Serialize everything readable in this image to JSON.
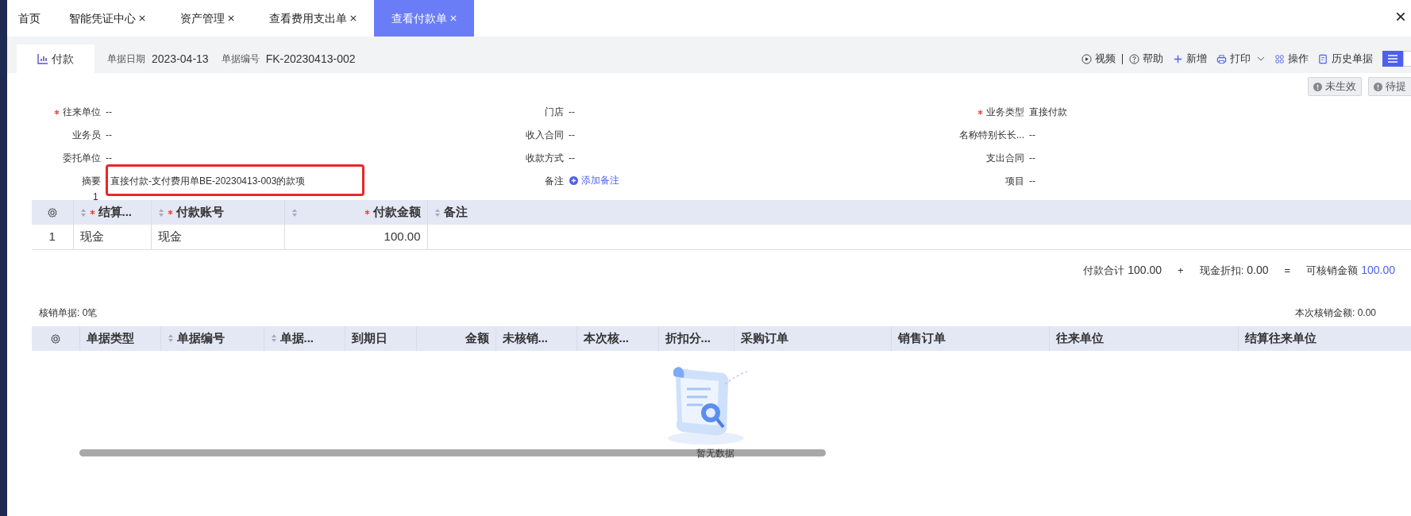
{
  "tabs": [
    {
      "label": "首页",
      "closable": false,
      "selected": false
    },
    {
      "label": "智能凭证中心",
      "closable": true,
      "selected": false
    },
    {
      "label": "资产管理",
      "closable": true,
      "selected": false
    },
    {
      "label": "查看费用支出单",
      "closable": true,
      "selected": false
    },
    {
      "label": "查看付款单",
      "closable": true,
      "selected": true
    }
  ],
  "doc_tab": "付款",
  "doc_meta": [
    {
      "label": "单据日期",
      "value": "2023-04-13"
    },
    {
      "label": "单据编号",
      "value": "FK-20230413-002"
    }
  ],
  "toolbar": [
    "视频",
    "帮助",
    "新增",
    "打印",
    "操作",
    "历史单据"
  ],
  "status_buttons": [
    "未生效",
    "待提"
  ],
  "form_rows": [
    [
      {
        "label": "往来单位",
        "value": "--",
        "required": true,
        "kind": "text"
      },
      {
        "label": "门店",
        "value": "--",
        "required": false,
        "kind": "text"
      },
      {
        "label": "业务类型",
        "value": "直接付款",
        "required": true,
        "kind": "text"
      }
    ],
    [
      {
        "label": "业务员",
        "value": "--",
        "required": false,
        "kind": "text"
      },
      {
        "label": "收入合同",
        "value": "--",
        "required": false,
        "kind": "text"
      },
      {
        "label": "名称特别长长...",
        "value": "--",
        "required": false,
        "kind": "text"
      }
    ],
    [
      {
        "label": "委托单位",
        "value": "--",
        "required": false,
        "kind": "text"
      },
      {
        "label": "收款方式",
        "value": "--",
        "required": false,
        "kind": "text"
      },
      {
        "label": "支出合同",
        "value": "--",
        "required": false,
        "kind": "text"
      }
    ],
    [
      {
        "label": "摘要",
        "value": "直接付款-支付费用单BE-20230413-003的款项",
        "required": false,
        "kind": "highlighted",
        "counter": "1"
      },
      {
        "label": "备注",
        "value": "添加备注",
        "required": false,
        "kind": "link"
      },
      {
        "label": "项目",
        "value": "--",
        "required": false,
        "kind": "text"
      }
    ]
  ],
  "payment_table": {
    "columns": [
      {
        "kind": "settings"
      },
      {
        "label": "结算...",
        "required": true,
        "sortable": true
      },
      {
        "label": "付款账号",
        "required": true,
        "sortable": true
      },
      {
        "label": "付款金额",
        "required": true,
        "sortable": true
      },
      {
        "label": "备注",
        "required": false,
        "sortable": true
      }
    ],
    "rows": [
      [
        "1",
        "现金",
        "现金",
        "100.00"
      ]
    ]
  },
  "totals": [
    {
      "label": "付款合计",
      "value": "100.00",
      "accent": false
    },
    {
      "label": "现金折扣:",
      "value": "0.00",
      "accent": false
    },
    {
      "label": "可核销金额",
      "value": "100.00",
      "accent": true
    }
  ],
  "operators": [
    "+",
    "="
  ],
  "writeoff_count": "核销单据: 0笔",
  "writeoff_amount": "本次核销金额: 0.00",
  "writeoff_table": {
    "columns": [
      {
        "kind": "settings"
      },
      {
        "label": "单据类型",
        "sortable": false
      },
      {
        "label": "单据编号",
        "sortable": true
      },
      {
        "label": "单据...",
        "sortable": true
      },
      {
        "label": "到期日",
        "sortable": false
      },
      {
        "label": "金额",
        "sortable": false
      },
      {
        "label": "未核销...",
        "sortable": false
      },
      {
        "label": "本次核...",
        "sortable": false
      },
      {
        "label": "折扣分...",
        "sortable": false
      },
      {
        "label": "采购订单",
        "sortable": false
      },
      {
        "label": "销售订单",
        "sortable": false
      },
      {
        "label": "往来单位",
        "sortable": false
      },
      {
        "label": "结算往来单位",
        "sortable": false
      }
    ],
    "empty_text": "暂无数据"
  }
}
